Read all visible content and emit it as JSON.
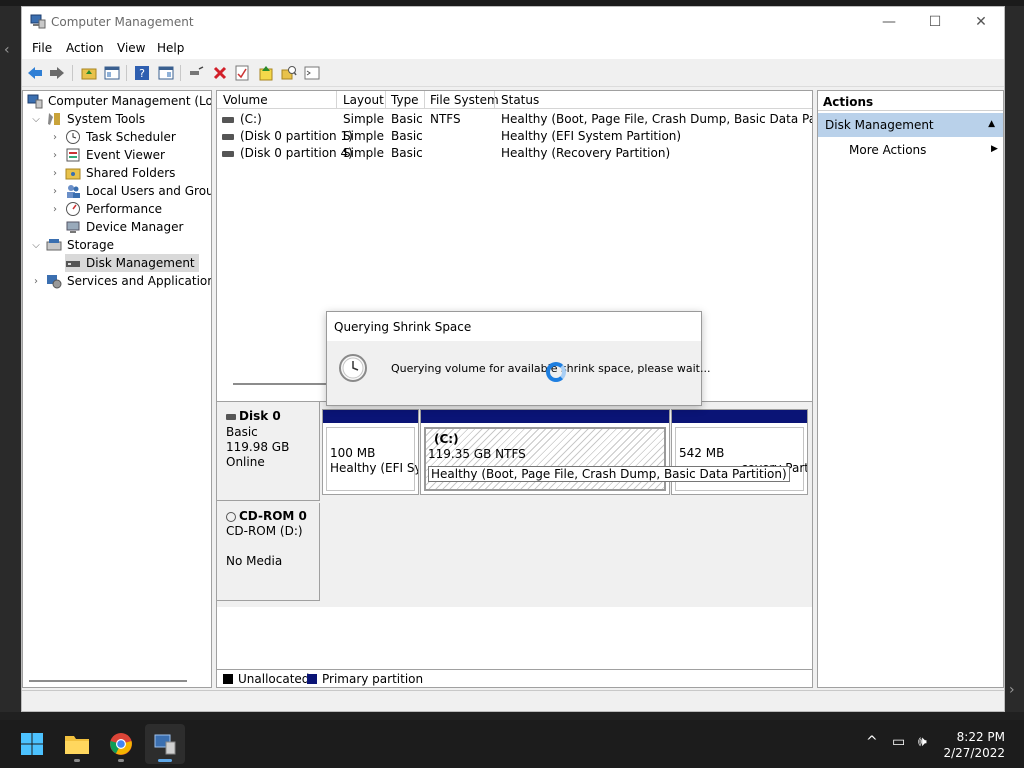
{
  "window": {
    "title": "Computer Management",
    "controls": {
      "minimize": "—",
      "maximize": "☐",
      "close": "✕"
    }
  },
  "menu": [
    "File",
    "Action",
    "View",
    "Help"
  ],
  "tree": {
    "root": "Computer Management (Local",
    "system_tools": "System Tools",
    "task_scheduler": "Task Scheduler",
    "event_viewer": "Event Viewer",
    "shared_folders": "Shared Folders",
    "local_users": "Local Users and Groups",
    "performance": "Performance",
    "device_manager": "Device Manager",
    "storage": "Storage",
    "disk_management": "Disk Management",
    "services": "Services and Applications"
  },
  "volumes": {
    "columns": [
      "Volume",
      "Layout",
      "Type",
      "File System",
      "Status"
    ],
    "rows": [
      {
        "volume": "(C:)",
        "layout": "Simple",
        "type": "Basic",
        "fs": "NTFS",
        "status": "Healthy (Boot, Page File, Crash Dump, Basic Data Partition)"
      },
      {
        "volume": "(Disk 0 partition 1)",
        "layout": "Simple",
        "type": "Basic",
        "fs": "",
        "status": "Healthy (EFI System Partition)"
      },
      {
        "volume": "(Disk 0 partition 4)",
        "layout": "Simple",
        "type": "Basic",
        "fs": "",
        "status": "Healthy (Recovery Partition)"
      }
    ]
  },
  "disk0": {
    "name": "Disk 0",
    "type": "Basic",
    "size": "119.98 GB",
    "state": "Online",
    "partitions": [
      {
        "size": "100 MB",
        "status": "Healthy (EFI Sys"
      },
      {
        "label": "(C:)",
        "size": "119.35 GB NTFS",
        "status": "Healthy (Boot, Page File, Crash Dump, Basic Data Partition)"
      },
      {
        "size": "542 MB",
        "status": "covery Part"
      }
    ]
  },
  "cdrom": {
    "name": "CD-ROM 0",
    "drive": "CD-ROM (D:)",
    "media": "No Media"
  },
  "legend": {
    "unallocated": "Unallocated",
    "primary": "Primary partition",
    "colors": {
      "unallocated": "#000000",
      "primary": "#0a1476"
    }
  },
  "actions": {
    "header": "Actions",
    "section": "Disk Management",
    "more": "More Actions"
  },
  "dialog": {
    "title": "Querying Shrink Space",
    "message": "Querying volume for available shrink space, please wait..."
  },
  "taskbar": {
    "apps": [
      "start-icon",
      "file-explorer-icon",
      "chrome-icon",
      "computer-management-icon"
    ],
    "time": "8:22 PM",
    "date": "2/27/2022"
  }
}
